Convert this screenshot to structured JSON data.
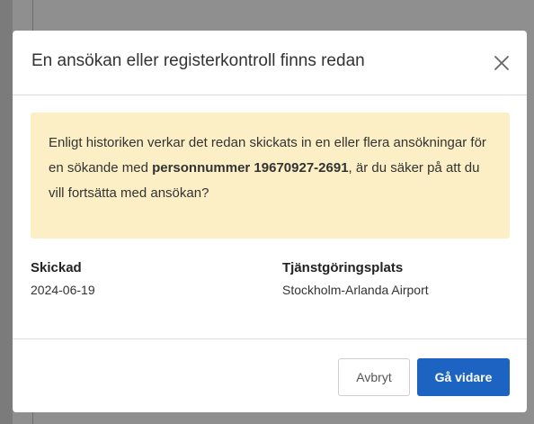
{
  "modal": {
    "title": "En ansökan eller registerkontroll finns redan",
    "close_icon": "close-icon"
  },
  "alert": {
    "text_before": "Enligt historiken verkar det redan skickats in en eller flera ansökningar för en sökande med ",
    "text_bold": "personnummer 19670927-2691",
    "text_after": ", är du säker på att du vill fortsätta med ansökan?",
    "background_color": "#fcefc6"
  },
  "details": {
    "sent_label": "Skickad",
    "sent_value": "2024-06-19",
    "workplace_label": "Tjänstgöringsplats",
    "workplace_value": "Stockholm-Arlanda Airport"
  },
  "footer": {
    "cancel_label": "Avbryt",
    "continue_label": "Gå vidare",
    "primary_color": "#1d64c2"
  }
}
